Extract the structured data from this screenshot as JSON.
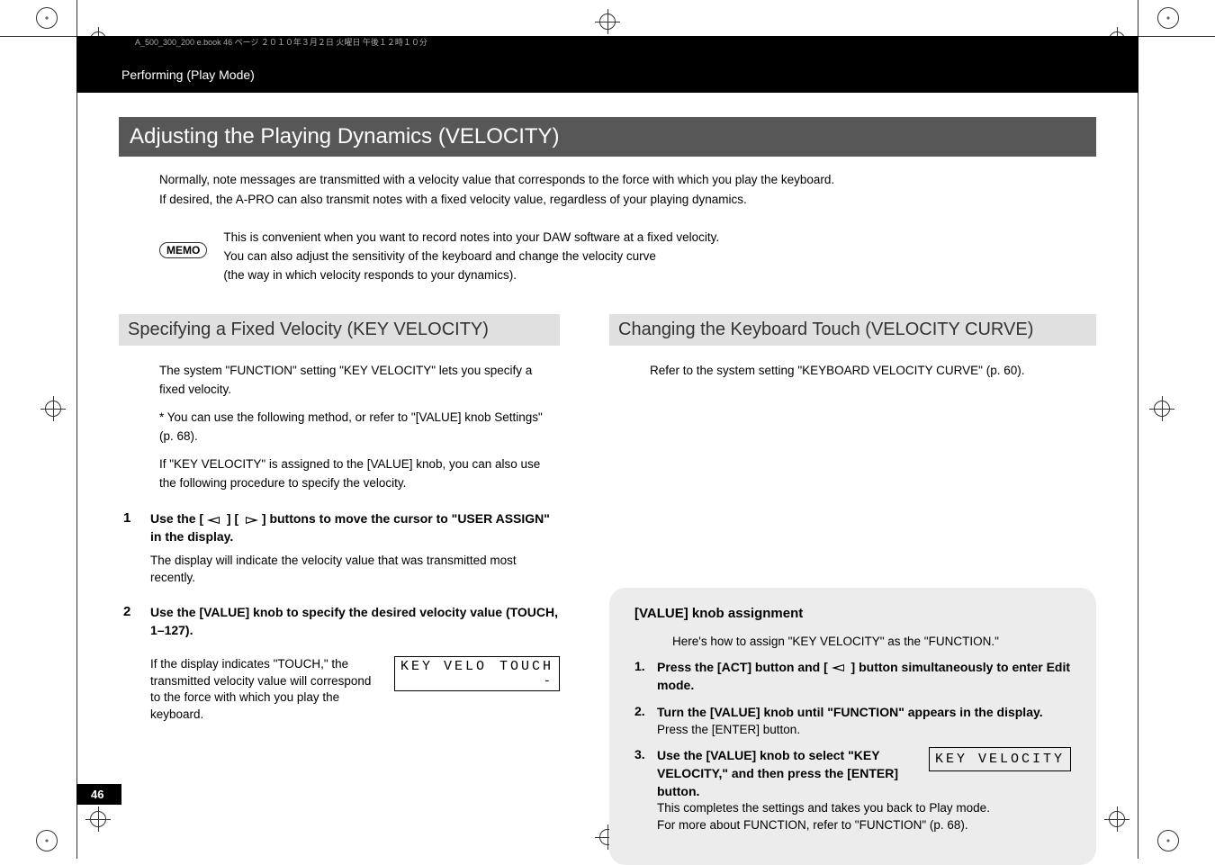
{
  "header": {
    "tiny": "A_500_300_200  e.book  46  ページ ２０１０年３月２日 火曜日 午後１２時１０分",
    "breadcrumb": "Performing (Play Mode)"
  },
  "main_title": "Adjusting the Playing Dynamics (VELOCITY)",
  "intro": {
    "line1": "Normally, note messages are transmitted with a velocity value that corresponds to the force with which you play the keyboard.",
    "line2": "If desired, the A-PRO can also transmit notes with a fixed velocity value, regardless of your playing dynamics."
  },
  "memo": {
    "label": "MEMO",
    "line1": "This is convenient when you want to record notes into your DAW software at a fixed velocity.",
    "line2": "You can also adjust the sensitivity of the keyboard and change the velocity curve",
    "line3": "(the way in which velocity responds to your dynamics)."
  },
  "left_section": {
    "title": "Specifying a Fixed Velocity (KEY VELOCITY)",
    "p1": "The system \"FUNCTION\" setting \"KEY VELOCITY\" lets you specify a fixed velocity.",
    "p2": "*  You can use the following method, or refer to  \"[VALUE] knob Settings\" (p. 68).",
    "p3": "If \"KEY VELOCITY\" is assigned to the [VALUE] knob, you can also use the following procedure to specify the velocity.",
    "step1": {
      "num": "1",
      "title_pre": "Use the [ ",
      "title_mid": " ] [ ",
      "title_post": " ] buttons to move the cursor to \"USER ASSIGN\" in the display.",
      "sub": "The display will indicate the velocity value that was transmitted most recently."
    },
    "step2": {
      "num": "2",
      "title": "Use the [VALUE] knob to specify the desired velocity value (TOUCH, 1–127).",
      "sub": "If the display indicates \"TOUCH,\" the transmitted velocity value will correspond to the force with which you play the keyboard.",
      "lcd_label": "KEY VELO",
      "lcd_value": "TOUCH",
      "lcd_sub": "-"
    }
  },
  "right_section": {
    "title": "Changing the Keyboard Touch (VELOCITY CURVE)",
    "p1": "Refer to the system setting  \"KEYBOARD VELOCITY CURVE\" (p. 60)."
  },
  "callout": {
    "title": "[VALUE] knob assignment",
    "intro": "Here's how to assign \"KEY VELOCITY\" as the \"FUNCTION.\"",
    "step1": {
      "num": "1.",
      "text_pre": "Press the [ACT] button and [ ",
      "text_post": " ] button simultaneously to enter Edit mode."
    },
    "step2": {
      "num": "2.",
      "bold": "Turn the [VALUE] knob until \"FUNCTION\" appears in the display.",
      "sub": "Press the [ENTER] button."
    },
    "step3": {
      "num": "3.",
      "bold": "Use the [VALUE] knob to select \"KEY VELOCITY,\" and then press the [ENTER] button.",
      "sub1": "This completes the settings and takes you back to Play mode.",
      "sub2": "For more about FUNCTION, refer to  \"FUNCTION\" (p. 68).",
      "lcd": "KEY VELOCITY"
    }
  },
  "page_num": "46"
}
